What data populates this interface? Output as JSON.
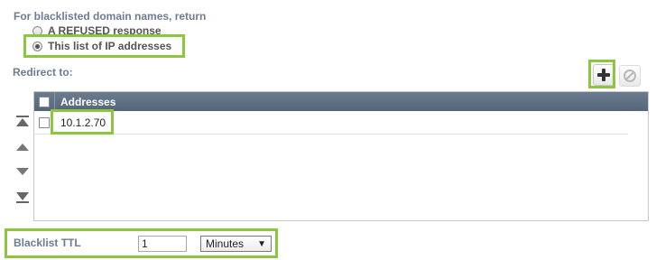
{
  "header": {
    "title": "For blacklisted domain names, return"
  },
  "options": [
    {
      "label": "A REFUSED response",
      "checked": false
    },
    {
      "label": "This list of IP addresses",
      "checked": true
    }
  ],
  "redirect": {
    "label": "Redirect to:"
  },
  "toolbar": {
    "add_icon": "plus-icon",
    "remove_icon": "disabled-icon"
  },
  "table": {
    "header": "Addresses",
    "rows": [
      {
        "address": "10.1.2.70"
      }
    ]
  },
  "move_controls": [
    "move-to-top-icon",
    "move-up-icon",
    "move-down-icon",
    "move-to-bottom-icon"
  ],
  "ttl": {
    "label": "Blacklist TTL",
    "value": "1",
    "unit": "Minutes",
    "unit_arrow": "▼"
  },
  "colors": {
    "highlight": "#8cc63f",
    "header_bg": "#5f6f84",
    "label": "#6d7c8f"
  }
}
